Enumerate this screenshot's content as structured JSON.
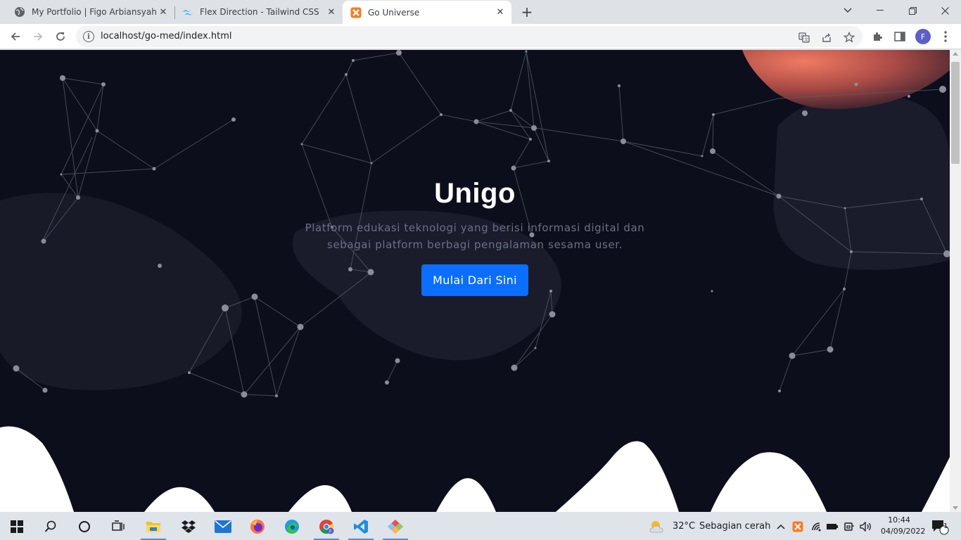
{
  "browser": {
    "tabs": [
      {
        "title": "My Portfolio | Figo Arbiansyah",
        "icon": "globe-icon"
      },
      {
        "title": "Flex Direction - Tailwind CSS",
        "icon": "tailwind-icon"
      },
      {
        "title": "Go Universe",
        "icon": "xampp-icon",
        "active": true
      }
    ],
    "new_tab": "+",
    "url": "localhost/go-med/index.html",
    "profile_initial": "F"
  },
  "page": {
    "title": "Unigo",
    "description": "Platform edukasi teknologi yang berisi informasi digital dan sebagai platform berbagi pengalaman sesama user.",
    "cta_label": "Mulai Dari Sini",
    "colors": {
      "background": "#0c0e1b",
      "accent": "#0b6efd",
      "blob": "#e8735f"
    }
  },
  "taskbar": {
    "weather_temp": "32°C",
    "weather_desc": "Sebagian cerah",
    "time": "10:44",
    "date": "04/09/2022",
    "notification_count": "1",
    "apps": [
      "file-explorer-icon",
      "dropbox-icon",
      "mail-icon",
      "firefox-icon",
      "edge-icon",
      "chrome-icon",
      "vscode-icon",
      "git-icon"
    ]
  }
}
